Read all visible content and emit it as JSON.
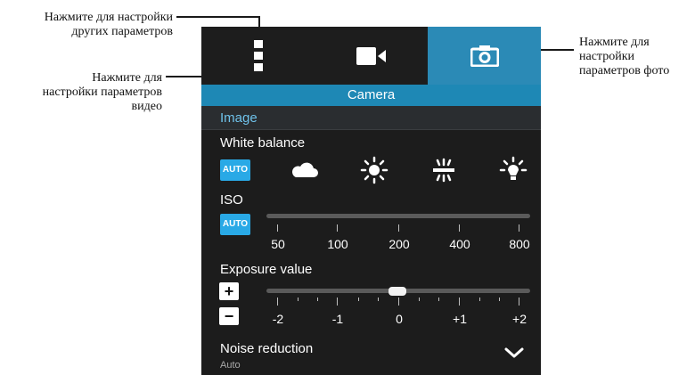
{
  "callouts": {
    "others": [
      "Нажмите для настройки",
      "других параметров"
    ],
    "video": [
      "Нажмите для",
      "настройки параметров",
      "видео"
    ],
    "photo": [
      "Нажмите для",
      "настройки",
      "параметров фото"
    ]
  },
  "tabs": [
    {
      "name": "others",
      "icon": "more-vertical-icon",
      "selected": false
    },
    {
      "name": "video",
      "icon": "video-camera-icon",
      "selected": false
    },
    {
      "name": "photo",
      "icon": "camera-icon",
      "selected": true
    }
  ],
  "mode_title": "Camera",
  "section_header": "Image",
  "white_balance": {
    "label": "White balance",
    "options": [
      {
        "icon": "auto-badge",
        "text": "AUTO",
        "selected": true
      },
      {
        "icon": "cloudy-icon"
      },
      {
        "icon": "daylight-icon"
      },
      {
        "icon": "fluorescent-icon"
      },
      {
        "icon": "incandescent-icon"
      }
    ]
  },
  "iso": {
    "label": "ISO",
    "auto_text": "AUTO",
    "ticks": [
      "50",
      "100",
      "200",
      "400",
      "800"
    ]
  },
  "exposure": {
    "label": "Exposure value",
    "plus": "+",
    "minus": "−",
    "ticks": [
      "-2",
      "-1",
      "0",
      "+1",
      "+2"
    ],
    "value": "0"
  },
  "noise_reduction": {
    "label": "Noise reduction",
    "value": "Auto"
  },
  "colors": {
    "accent": "#2b8ab6",
    "mode_bar": "#1e88b5",
    "auto_badge": "#29a9e6",
    "section_text": "#6fc2ea",
    "panel": "#1c1c1c"
  }
}
